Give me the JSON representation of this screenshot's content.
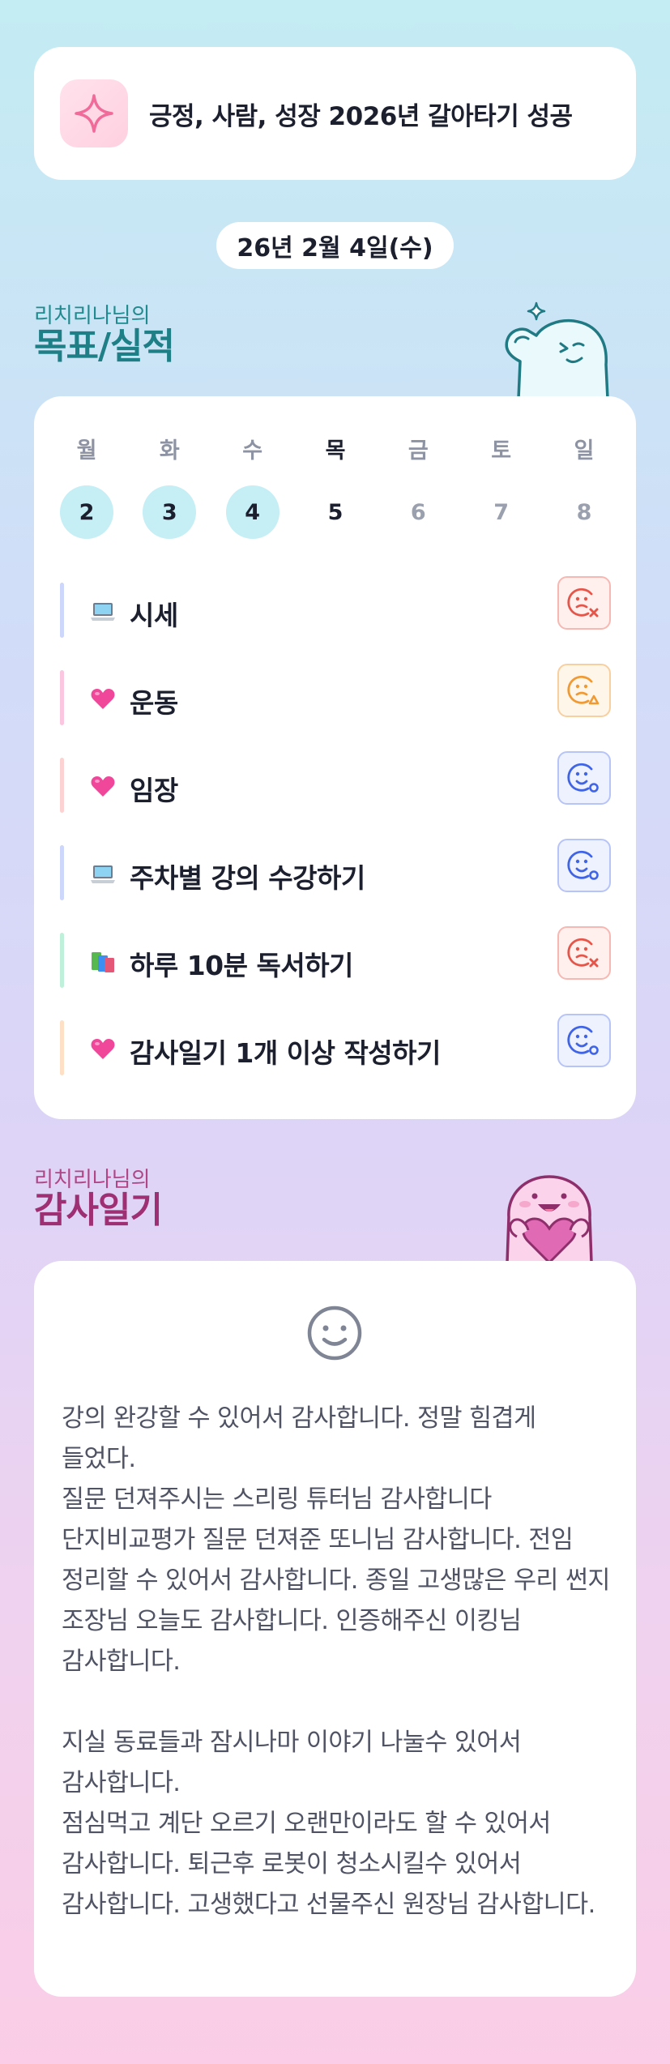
{
  "header": {
    "goal_title": "긍정, 사람, 성장 2026년 갈아타기 성공",
    "goal_icon": "sparkle-icon"
  },
  "date_label": "26년 2월 4일(수)",
  "goals_section": {
    "owner": "리치리나님의",
    "title": "목표/실적"
  },
  "week": [
    {
      "day": "월",
      "date": "2",
      "state": "done"
    },
    {
      "day": "화",
      "date": "3",
      "state": "done"
    },
    {
      "day": "수",
      "date": "4",
      "state": "done"
    },
    {
      "day": "목",
      "date": "5",
      "state": "today"
    },
    {
      "day": "금",
      "date": "6",
      "state": "future"
    },
    {
      "day": "토",
      "date": "7",
      "state": "future"
    },
    {
      "day": "일",
      "date": "8",
      "state": "future"
    }
  ],
  "goals": [
    {
      "label": "시세",
      "emoji": "laptop-icon",
      "bar_color": "#cdd6fb",
      "status": "fail"
    },
    {
      "label": "운동",
      "emoji": "heart-icon",
      "bar_color": "#fbc6e0",
      "status": "partial"
    },
    {
      "label": "임장",
      "emoji": "heart-icon",
      "bar_color": "#fcd3d2",
      "status": "success"
    },
    {
      "label": "주차별 강의 수강하기",
      "emoji": "laptop-icon",
      "bar_color": "#cdd6fb",
      "status": "success"
    },
    {
      "label": "하루 10분 독서하기",
      "emoji": "books-icon",
      "bar_color": "#bff0d9",
      "status": "fail"
    },
    {
      "label": "감사일기 1개 이상 작성하기",
      "emoji": "heart-icon",
      "bar_color": "#fde0c6",
      "status": "success"
    }
  ],
  "status_colors": {
    "fail": "#e5564a",
    "partial": "#f09a34",
    "success": "#3f64e6"
  },
  "gratitude_section": {
    "owner": "리치리나님의",
    "title": "감사일기"
  },
  "gratitude_icon": "smile-icon",
  "gratitude_text": "강의 완강할 수 있어서 감사합니다. 정말 힘겹게 들었다.\n질문 던져주시는 스리링 튜터님 감사합니다  단지비교평가 질문 던져준 또니님 감사합니다. 전임 정리할 수 있어서 감사합니다. 종일 고생많은 우리 썬지 조장님 오늘도 감사합니다. 인증해주신 이킹님 감사합니다.\n\n지실 동료들과 잠시나마 이야기 나눌수 있어서 감사합니다.\n점심먹고 계단 오르기 오랜만이라도 할 수 있어서 감사합니다. 퇴근후 로봇이 청소시킬수 있어서 감사합니다. 고생했다고 선물주신 원장님 감사합니다."
}
